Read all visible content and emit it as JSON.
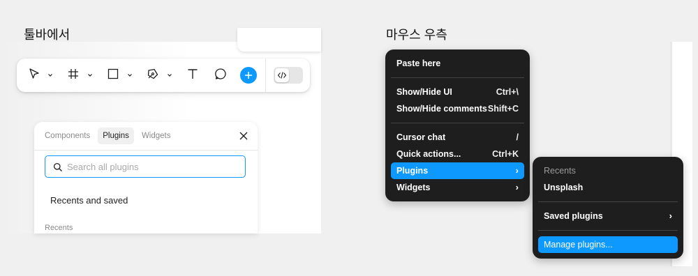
{
  "captions": {
    "toolbar": "툴바에서",
    "right_click": "마우스 우측"
  },
  "toolbar": {
    "tools": [
      {
        "icon": "move-arrow-icon",
        "has_dropdown": true
      },
      {
        "icon": "frame-hash-icon",
        "has_dropdown": true
      },
      {
        "icon": "rectangle-icon",
        "has_dropdown": true
      },
      {
        "icon": "pen-icon",
        "has_dropdown": true
      },
      {
        "icon": "text-icon",
        "has_dropdown": false
      },
      {
        "icon": "comment-icon",
        "has_dropdown": false
      }
    ],
    "actions_button": {
      "icon": "plus-icon",
      "color": "#0d99ff"
    },
    "dev_mode_toggle": {
      "icon": "code-icon",
      "on": false
    }
  },
  "plugins_panel": {
    "tabs": [
      {
        "label": "Components",
        "active": false
      },
      {
        "label": "Plugins",
        "active": true
      },
      {
        "label": "Widgets",
        "active": false
      }
    ],
    "close_icon": "close-icon",
    "search": {
      "placeholder": "Search all plugins",
      "value": ""
    },
    "recents_and_saved": "Recents and saved",
    "recents_label": "Recents"
  },
  "context_menu": {
    "groups": [
      [
        {
          "label": "Paste here",
          "shortcut": ""
        }
      ],
      [
        {
          "label": "Show/Hide UI",
          "shortcut": "Ctrl+\\"
        },
        {
          "label": "Show/Hide comments",
          "shortcut": "Shift+C"
        }
      ],
      [
        {
          "label": "Cursor chat",
          "shortcut": "/"
        },
        {
          "label": "Quick actions...",
          "shortcut": "Ctrl+K"
        },
        {
          "label": "Plugins",
          "submenu": true,
          "highlighted": true
        },
        {
          "label": "Widgets",
          "submenu": true
        }
      ]
    ]
  },
  "submenu": {
    "recents_label": "Recents",
    "items": [
      {
        "label": "Unsplash"
      },
      {
        "label": "Saved plugins",
        "submenu": true
      },
      {
        "label": "Manage plugins...",
        "highlighted": true
      }
    ]
  },
  "colors": {
    "accent": "#0d99ff",
    "menu_bg": "#1e1e1e",
    "page_bg": "#f0f0f0"
  }
}
